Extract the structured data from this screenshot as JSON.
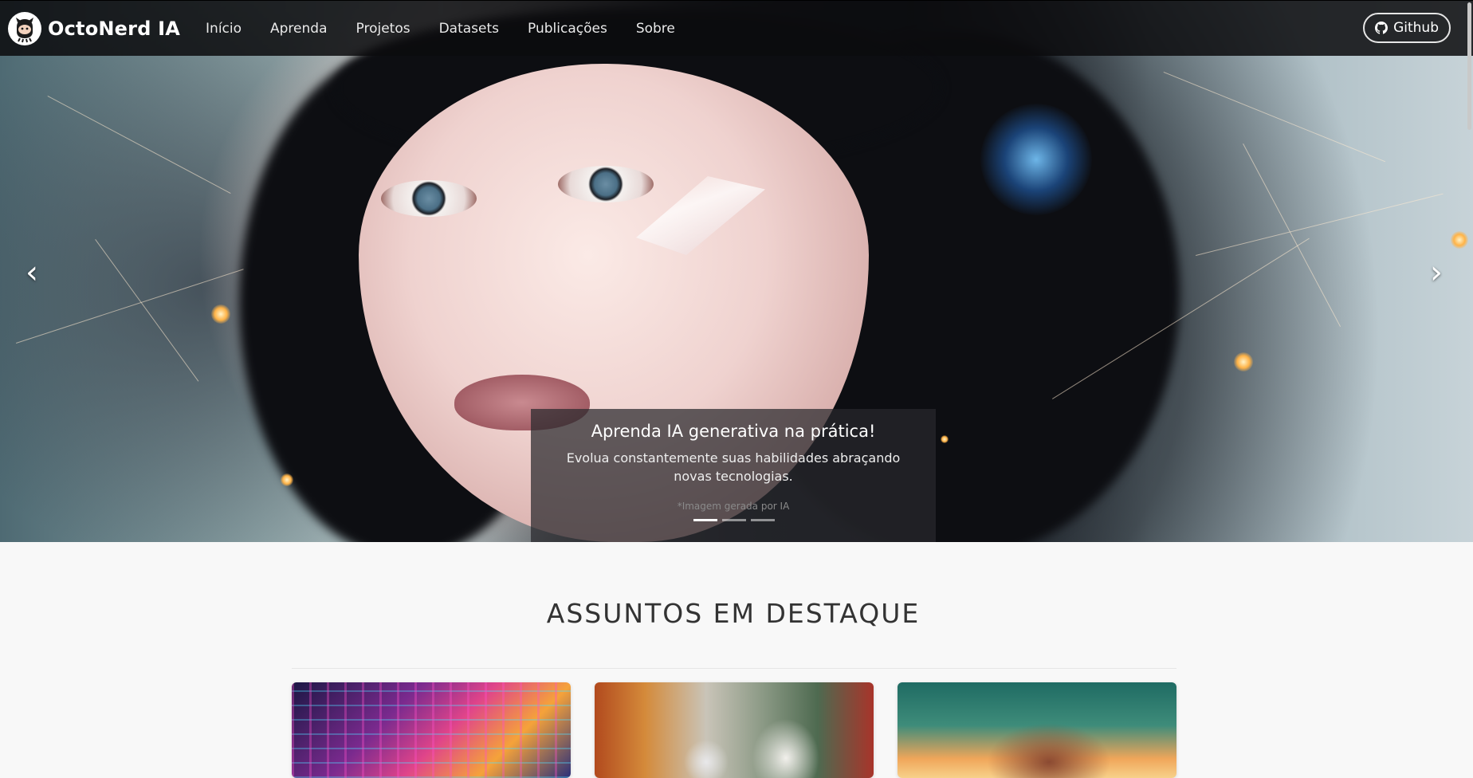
{
  "navbar": {
    "brand": "OctoNerd IA",
    "links": [
      "Início",
      "Aprenda",
      "Projetos",
      "Datasets",
      "Publicações",
      "Sobre"
    ],
    "github_label": "Github"
  },
  "hero": {
    "caption_title": "Aprenda IA generativa na prática!",
    "caption_text": "Evolua constantemente suas habilidades abraçando novas tecnologias.",
    "caption_credit": "*Imagem gerada por IA",
    "slides": 3,
    "active_slide": 1
  },
  "section": {
    "title": "ASSUNTOS EM DESTAQUE"
  },
  "colors": {
    "navbar_bg": "#0c0c0e",
    "page_bg": "#f8f8f8",
    "caption_bg": "#28282c"
  }
}
